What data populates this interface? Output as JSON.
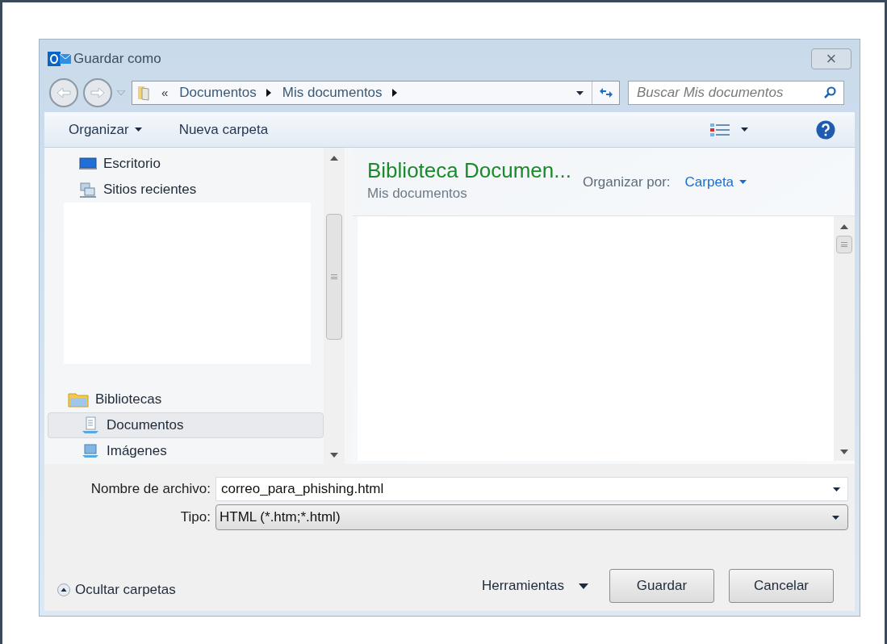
{
  "window": {
    "title": "Guardar como",
    "close": "×"
  },
  "address": {
    "back_disabled": true,
    "forward_disabled": true,
    "overflow": "«",
    "path": [
      "Documentos",
      "Mis documentos"
    ]
  },
  "search": {
    "placeholder": "Buscar Mis documentos"
  },
  "toolbar": {
    "items": [
      {
        "label": "Organizar",
        "dropdown": true
      },
      {
        "label": "Nueva carpeta",
        "dropdown": false
      }
    ]
  },
  "nav": [
    {
      "label": "Escritorio",
      "kind": "desktop",
      "selected": false
    },
    {
      "label": "Sitios recientes",
      "kind": "recent",
      "selected": false
    },
    {
      "label": "Bibliotecas",
      "kind": "library",
      "selected": false,
      "children": [
        {
          "label": "Documentos",
          "kind": "documents",
          "selected": true
        },
        {
          "label": "Imágenes",
          "kind": "pictures",
          "selected": false
        }
      ]
    }
  ],
  "library": {
    "title": "Biblioteca Documen...",
    "subtitle": "Mis documentos",
    "arrange_label": "Organizar por:",
    "arrange_value": "Carpeta"
  },
  "form": {
    "filename_label": "Nombre de archivo:",
    "filename": "correo_para_phishing.html",
    "type_label": "Tipo:",
    "type": "HTML (*.htm;*.html)"
  },
  "footer": {
    "hide_folders": "Ocultar carpetas",
    "tools": "Herramientas",
    "buttons": [
      "Guardar",
      "Cancelar"
    ]
  }
}
